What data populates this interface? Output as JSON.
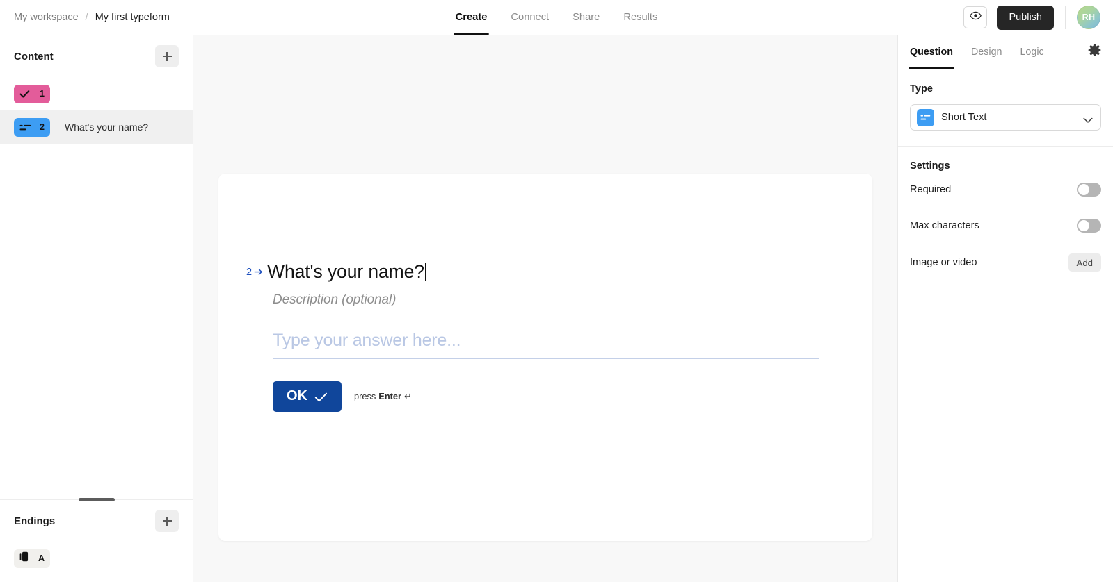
{
  "topbar": {
    "workspace": "My workspace",
    "separator": "/",
    "form_title": "My first typeform",
    "tabs": [
      {
        "label": "Create",
        "active": true
      },
      {
        "label": "Connect",
        "active": false
      },
      {
        "label": "Share",
        "active": false
      },
      {
        "label": "Results",
        "active": false
      }
    ],
    "preview_icon": "eye-icon",
    "publish_label": "Publish",
    "avatar_initials": "RH"
  },
  "sidebar": {
    "content_title": "Content",
    "add_label": "+",
    "questions": [
      {
        "badge_num": "1",
        "icon": "check-icon",
        "badge_color": "#e35c9a",
        "label": ""
      },
      {
        "badge_num": "2",
        "icon": "short-text-icon",
        "badge_color": "#3d9df3",
        "label": "What's your name?"
      }
    ],
    "endings_title": "Endings",
    "endings": [
      {
        "badge_num": "A",
        "icon": "ending-card-icon",
        "badge_color": "#f1f0ed"
      }
    ]
  },
  "canvas": {
    "question_index": "2",
    "index_arrow": "➜",
    "question_text": "What's your name?",
    "description_placeholder": "Description (optional)",
    "answer_placeholder": "Type your answer here...",
    "ok_label": "OK",
    "ok_icon": "check-icon",
    "press_prefix": "press",
    "press_key": "Enter",
    "press_return_glyph": "↵"
  },
  "right_panel": {
    "tabs": [
      {
        "label": "Question",
        "active": true
      },
      {
        "label": "Design",
        "active": false
      },
      {
        "label": "Logic",
        "active": false
      }
    ],
    "settings_icon": "gear-icon",
    "type_label": "Type",
    "type_value": "Short Text",
    "type_icon": "short-text-icon",
    "settings_label": "Settings",
    "rows": [
      {
        "label": "Required",
        "toggle": "off"
      },
      {
        "label": "Max characters",
        "toggle": "off"
      }
    ],
    "media_label": "Image or video",
    "media_button": "Add"
  },
  "colors": {
    "accent_blue": "#3d9df3",
    "pink": "#e35c9a",
    "ok_blue": "#10469b",
    "dark": "#262626",
    "canvas_bg": "#f8f8f8"
  }
}
